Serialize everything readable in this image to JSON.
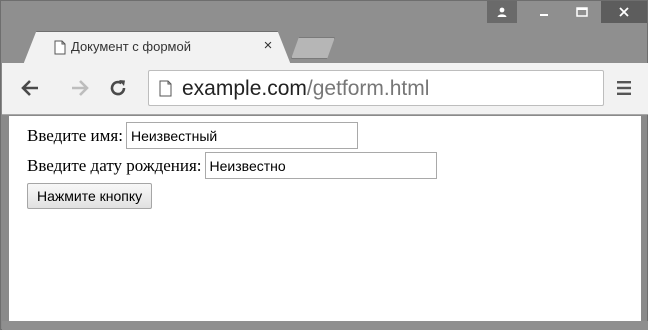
{
  "tab": {
    "title": "Документ с формой",
    "close_glyph": "×",
    "page_icon": "document-icon"
  },
  "window_controls": {
    "user_glyph": "👤",
    "minimize_glyph": "_",
    "maximize_glyph": "☐",
    "close_glyph": "✕"
  },
  "toolbar": {
    "back_icon": "back-arrow-icon",
    "forward_icon": "forward-arrow-icon",
    "reload_icon": "reload-icon",
    "menu_icon": "hamburger-menu-icon",
    "url_host": "example.com",
    "url_path": "/getform.html"
  },
  "form": {
    "name_label": "Введите имя:",
    "name_value": "Неизвестный",
    "birthdate_label": "Введите дату рождения:",
    "birthdate_value": "Неизвестно",
    "submit_label": "Нажмите кнопку"
  },
  "colors": {
    "chrome_frame": "#8f8f8f",
    "toolbar_bg": "#f2f2f2"
  }
}
